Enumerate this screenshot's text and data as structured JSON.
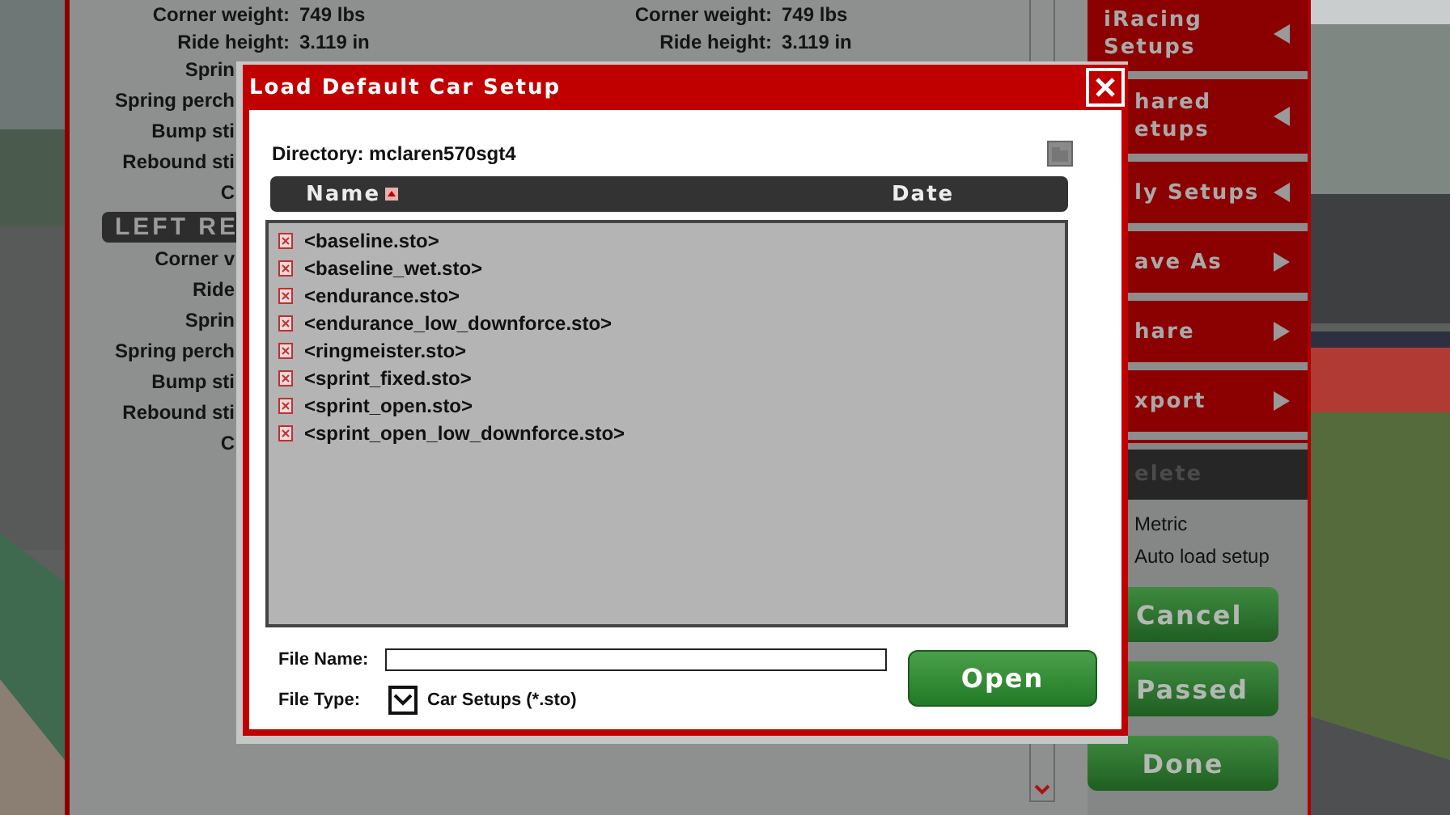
{
  "setup_top_rows": [
    {
      "label": "Corner weight:",
      "value": "749 lbs",
      "right_label": "Corner weight:",
      "right_value": "749 lbs"
    },
    {
      "label": "Ride height:",
      "value": "3.119 in",
      "right_label": "Ride height:",
      "right_value": "3.119 in"
    }
  ],
  "setup_rows": [
    "Sprin",
    "Spring perch",
    "Bump sti",
    "Rebound sti",
    "C"
  ],
  "section_badge": "LEFT RE",
  "section_rows": [
    "Corner v",
    "Ride",
    "Sprin",
    "Spring perch",
    "Bump sti",
    "Rebound sti",
    "C"
  ],
  "sidebar": {
    "menu": [
      {
        "lines": [
          "iRacing",
          "Setups"
        ],
        "kind": "submenu"
      },
      {
        "lines": [
          "hared",
          "etups"
        ],
        "kind": "submenu"
      },
      {
        "lines": [
          "ly Setups"
        ],
        "kind": "submenu"
      },
      {
        "lines": [
          "ave As"
        ],
        "kind": "action"
      },
      {
        "lines": [
          "hare"
        ],
        "kind": "action"
      },
      {
        "lines": [
          "xport"
        ],
        "kind": "action"
      }
    ],
    "delete": "elete",
    "options": [
      "Metric",
      "Auto load setup"
    ],
    "buttons": [
      "Cancel",
      "Passed",
      "Done"
    ]
  },
  "dialog": {
    "title": "Load Default Car Setup",
    "directory_label": "Directory:",
    "directory": "mclaren570sgt4",
    "columns": [
      {
        "label": "Name",
        "sorted": true
      },
      {
        "label": "Date",
        "sorted": false
      }
    ],
    "files": [
      "<baseline.sto>",
      "<baseline_wet.sto>",
      "<endurance.sto>",
      "<endurance_low_downforce.sto>",
      "<ringmeister.sto>",
      "<sprint_fixed.sto>",
      "<sprint_open.sto>",
      "<sprint_open_low_downforce.sto>"
    ],
    "file_name_label": "File Name:",
    "file_type_label": "File Type:",
    "file_type": "Car Setups (*.sto)",
    "open_button": "Open"
  }
}
